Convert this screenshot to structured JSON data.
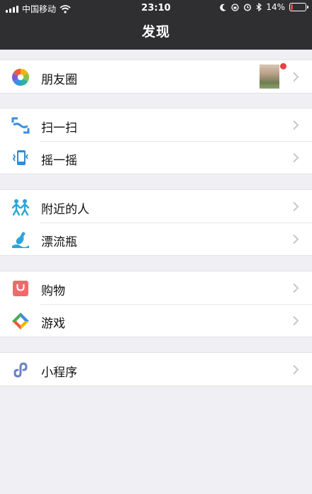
{
  "status_bar": {
    "carrier": "中国移动",
    "time": "23:10",
    "battery_percent": "14%",
    "battery_level": 0.14,
    "icons": [
      "signal-icon",
      "wifi-icon",
      "moon-icon",
      "lock-rotation-icon",
      "alarm-icon",
      "bluetooth-icon",
      "battery-icon"
    ]
  },
  "nav": {
    "title": "发现"
  },
  "groups": [
    {
      "items": [
        {
          "label": "朋友圈",
          "icon": "moments-icon",
          "has_thumbnail": true,
          "badge": "red-dot"
        }
      ]
    },
    {
      "items": [
        {
          "label": "扫一扫",
          "icon": "scan-icon"
        },
        {
          "label": "摇一摇",
          "icon": "shake-icon"
        }
      ]
    },
    {
      "items": [
        {
          "label": "附近的人",
          "icon": "people-nearby-icon"
        },
        {
          "label": "漂流瓶",
          "icon": "drift-bottle-icon"
        }
      ]
    },
    {
      "items": [
        {
          "label": "购物",
          "icon": "shopping-bag-icon"
        },
        {
          "label": "游戏",
          "icon": "games-icon"
        }
      ]
    },
    {
      "items": [
        {
          "label": "小程序",
          "icon": "mini-program-icon"
        }
      ]
    }
  ],
  "colors": {
    "nav_bg": "#2f2f32",
    "page_bg": "#efeff4",
    "badge_red": "#e64340"
  }
}
